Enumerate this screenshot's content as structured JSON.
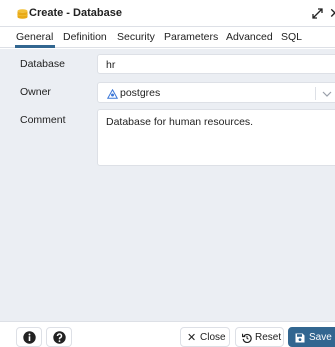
{
  "dialog": {
    "title": "Create - Database",
    "title_icon": "database-icon",
    "window_controls": [
      "expand-icon",
      "close-icon"
    ]
  },
  "tabs": [
    {
      "label": "General",
      "active": true
    },
    {
      "label": "Definition",
      "active": false
    },
    {
      "label": "Security",
      "active": false
    },
    {
      "label": "Parameters",
      "active": false
    },
    {
      "label": "Advanced",
      "active": false
    },
    {
      "label": "SQL",
      "active": false
    }
  ],
  "form": {
    "database": {
      "label": "Database",
      "value": "hr"
    },
    "owner": {
      "label": "Owner",
      "value": "postgres",
      "icon": "user-icon"
    },
    "comment": {
      "label": "Comment",
      "value": "Database for human resources."
    }
  },
  "footer": {
    "info_icon": "info-icon",
    "help_icon": "help-icon",
    "close_label": "Close",
    "reset_label": "Reset",
    "save_label": "Save"
  },
  "colors": {
    "accent": "#326690",
    "database_icon": "#f2c037",
    "owner_icon": "#3c78d8",
    "form_background": "#ebeef3",
    "border": "#dde0e6"
  }
}
